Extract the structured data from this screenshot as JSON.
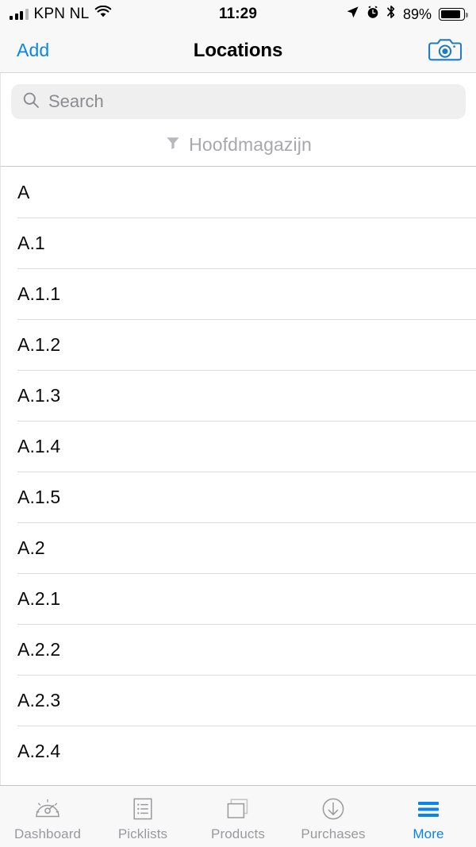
{
  "status_bar": {
    "carrier": "KPN NL",
    "wifi_icon": "wifi-icon",
    "signal_icon": "cellular-signal-icon",
    "time": "11:29",
    "location_icon": "location-arrow-icon",
    "alarm_icon": "alarm-clock-icon",
    "bluetooth_icon": "bluetooth-icon",
    "battery_percent": "89%",
    "battery_icon": "battery-icon",
    "battery_level": 89
  },
  "nav_bar": {
    "left_button": "Add",
    "title": "Locations",
    "right_icon": "camera-icon"
  },
  "search": {
    "placeholder": "Search",
    "value": "",
    "icon": "search-icon"
  },
  "filter": {
    "icon": "funnel-icon",
    "label": "Hoofdmagazijn"
  },
  "list": {
    "items": [
      {
        "label": "A"
      },
      {
        "label": "A.1"
      },
      {
        "label": "A.1.1"
      },
      {
        "label": "A.1.2"
      },
      {
        "label": "A.1.3"
      },
      {
        "label": "A.1.4"
      },
      {
        "label": "A.1.5"
      },
      {
        "label": "A.2"
      },
      {
        "label": "A.2.1"
      },
      {
        "label": "A.2.2"
      },
      {
        "label": "A.2.3"
      },
      {
        "label": "A.2.4"
      }
    ]
  },
  "tab_bar": {
    "active": "More",
    "tabs": [
      {
        "label": "Dashboard",
        "icon": "gauge-icon"
      },
      {
        "label": "Picklists",
        "icon": "list-document-icon"
      },
      {
        "label": "Products",
        "icon": "stacked-squares-icon"
      },
      {
        "label": "Purchases",
        "icon": "arrow-down-circle-icon"
      },
      {
        "label": "More",
        "icon": "hamburger-menu-icon"
      }
    ]
  },
  "colors": {
    "accent": "#0a84e8",
    "inactive": "#9a9a9e",
    "separator": "#dcdcde",
    "bar_background": "#f8f8f8"
  }
}
